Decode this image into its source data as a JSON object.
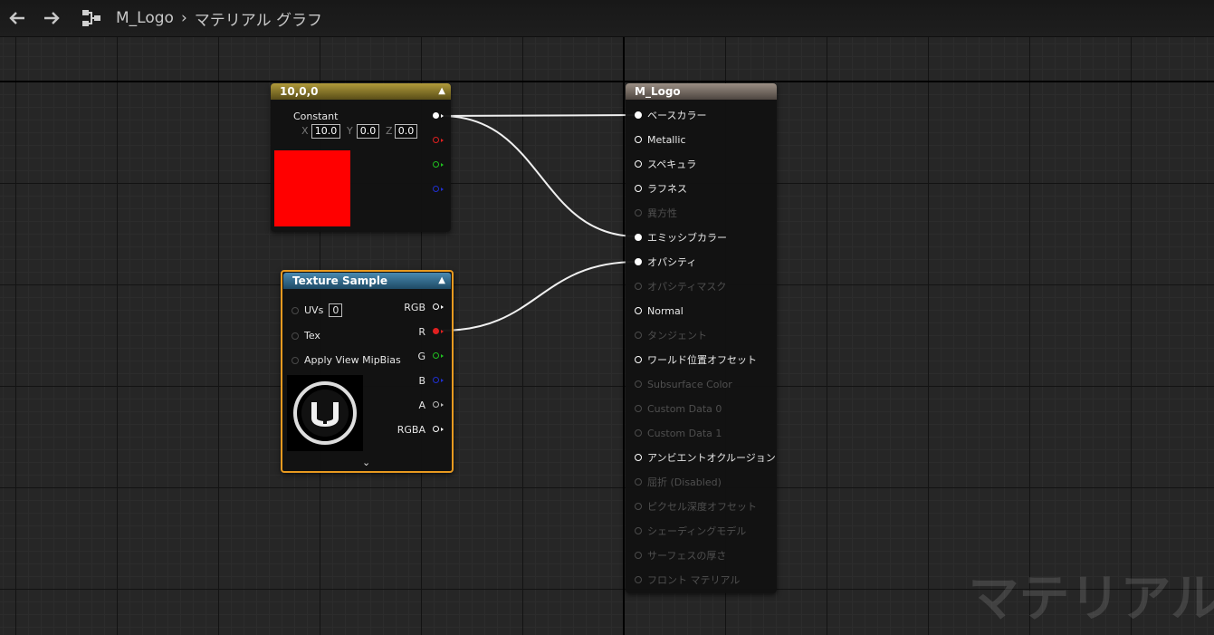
{
  "breadcrumb": {
    "asset": "M_Logo",
    "graph": "マテリアル グラフ"
  },
  "watermark": "マテリアル",
  "constant_node": {
    "title": "10,0,0",
    "label": "Constant",
    "x_label": "X",
    "x_value": "10.0",
    "y_label": "Y",
    "y_value": "0.0",
    "z_label": "Z",
    "z_value": "0.0",
    "preview_color": "#ff0000"
  },
  "texture_node": {
    "title": "Texture Sample",
    "inputs": [
      {
        "label": "UVs",
        "value": "0"
      },
      {
        "label": "Tex"
      },
      {
        "label": "Apply View MipBias"
      }
    ],
    "outputs": [
      {
        "label": "RGB",
        "color": "#ffffff"
      },
      {
        "label": "R",
        "color": "#e02020"
      },
      {
        "label": "G",
        "color": "#20c020"
      },
      {
        "label": "B",
        "color": "#2020d0"
      },
      {
        "label": "A",
        "color": "#bbbbbb"
      },
      {
        "label": "RGBA",
        "color": "#ffffff"
      }
    ]
  },
  "material_node": {
    "title": "M_Logo",
    "inputs": [
      {
        "label": "ベースカラー",
        "connected": true,
        "enabled": true
      },
      {
        "label": "Metallic",
        "connected": false,
        "enabled": true
      },
      {
        "label": "スペキュラ",
        "connected": false,
        "enabled": true
      },
      {
        "label": "ラフネス",
        "connected": false,
        "enabled": true
      },
      {
        "label": "異方性",
        "connected": false,
        "enabled": false
      },
      {
        "label": "エミッシブカラー",
        "connected": true,
        "enabled": true
      },
      {
        "label": "オパシティ",
        "connected": true,
        "enabled": true
      },
      {
        "label": "オパシティマスク",
        "connected": false,
        "enabled": false
      },
      {
        "label": "Normal",
        "connected": false,
        "enabled": true
      },
      {
        "label": "タンジェント",
        "connected": false,
        "enabled": false
      },
      {
        "label": "ワールド位置オフセット",
        "connected": false,
        "enabled": true
      },
      {
        "label": "Subsurface Color",
        "connected": false,
        "enabled": false
      },
      {
        "label": "Custom Data 0",
        "connected": false,
        "enabled": false
      },
      {
        "label": "Custom Data 1",
        "connected": false,
        "enabled": false
      },
      {
        "label": "アンビエントオクルージョン",
        "connected": false,
        "enabled": true
      },
      {
        "label": "屈折 (Disabled)",
        "connected": false,
        "enabled": false
      },
      {
        "label": "ピクセル深度オフセット",
        "connected": false,
        "enabled": false
      },
      {
        "label": "シェーディングモデル",
        "connected": false,
        "enabled": false
      },
      {
        "label": "サーフェスの厚さ",
        "connected": false,
        "enabled": false
      },
      {
        "label": "フロント マテリアル",
        "connected": false,
        "enabled": false
      }
    ]
  },
  "colors": {
    "constant_header": "#8a7a2a",
    "texture_header": "#2f5f7f",
    "material_header": "#7a6e64",
    "selection": "#e89a20"
  }
}
